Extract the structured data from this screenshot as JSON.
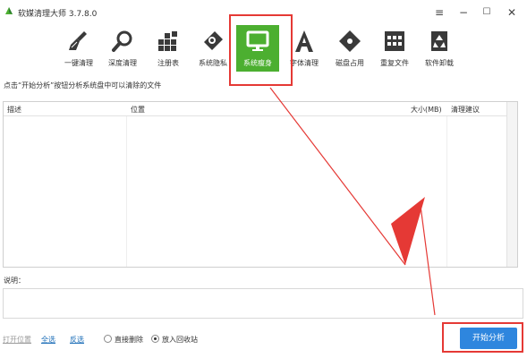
{
  "window": {
    "title": "软媒清理大师 3.7.8.0",
    "menu_glyph": "≡",
    "minimize_glyph": "−",
    "maximize_glyph": "☐",
    "close_glyph": "✕"
  },
  "toolbar": {
    "items": [
      {
        "label": "一键清理",
        "icon": "broom-icon"
      },
      {
        "label": "深度清理",
        "icon": "magnifier-icon"
      },
      {
        "label": "注册表",
        "icon": "registry-blocks-icon"
      },
      {
        "label": "系统隐私",
        "icon": "privacy-eraser-icon"
      },
      {
        "label": "系统瘦身",
        "icon": "monitor-icon",
        "active": true
      },
      {
        "label": "字体清理",
        "icon": "font-a-icon"
      },
      {
        "label": "磁盘占用",
        "icon": "disk-tag-icon"
      },
      {
        "label": "重复文件",
        "icon": "duplicate-files-icon"
      },
      {
        "label": "软件卸载",
        "icon": "recycle-icon"
      }
    ],
    "active_color": "#4caf30"
  },
  "hint": "点击“开始分析”按钮分析系统盘中可以清除的文件",
  "table": {
    "columns": [
      "描述",
      "位置",
      "大小(MB)",
      "清理建议"
    ]
  },
  "description_label": "说明：",
  "bottom": {
    "open_location": "打开位置",
    "select_all": "全选",
    "invert": "反选",
    "radio_delete": "直接删除",
    "radio_recycle": "放入回收站",
    "selected_radio": "radio_recycle",
    "analyze_button": "开始分析"
  },
  "colors": {
    "accent": "#2e86de",
    "annotation": "#e53935"
  }
}
